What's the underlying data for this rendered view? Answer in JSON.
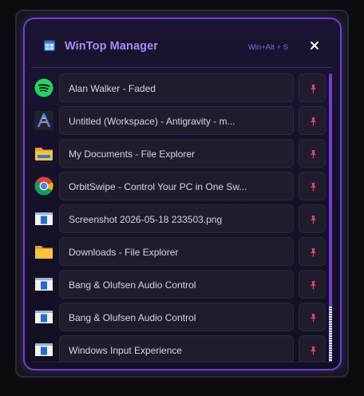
{
  "app": {
    "title": "WinTop Manager",
    "hotkey": "Win+Alt + S",
    "icon": "window-grid-icon",
    "close_icon": "close-icon"
  },
  "windows": [
    {
      "title": "Alan Walker - Faded",
      "icon": "spotify-icon"
    },
    {
      "title": "Untitled (Workspace) - Antigravity - m...",
      "icon": "antigravity-icon"
    },
    {
      "title": "My Documents - File Explorer",
      "icon": "folder-icon"
    },
    {
      "title": "OrbitSwipe - Control Your PC in One Sw...",
      "icon": "chrome-icon"
    },
    {
      "title": "Screenshot 2026-05-18 233503.png",
      "icon": "app-window-icon"
    },
    {
      "title": "Downloads - File Explorer",
      "icon": "folder-icon"
    },
    {
      "title": "Bang & Olufsen Audio Control",
      "icon": "app-window-icon"
    },
    {
      "title": "Bang & Olufsen Audio Control",
      "icon": "app-window-icon"
    },
    {
      "title": "Windows Input Experience",
      "icon": "app-window-icon"
    }
  ],
  "colors": {
    "accent": "#6d3fd6",
    "title": "#a98cf5",
    "pin": "#e0455d"
  }
}
